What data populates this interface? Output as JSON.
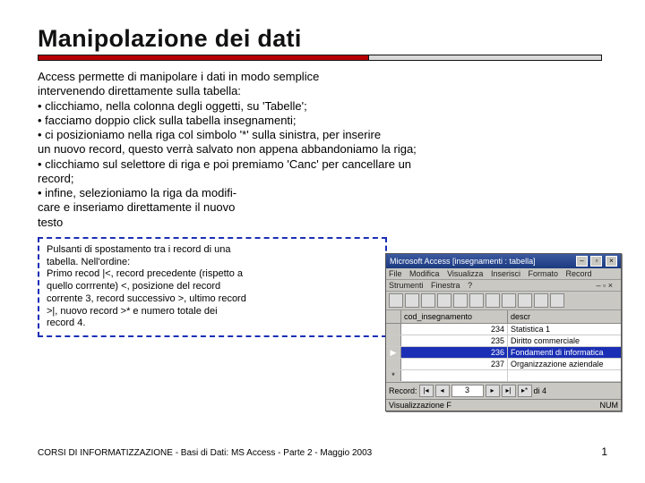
{
  "title": "Manipolazione dei dati",
  "body": {
    "intro1": "Access permette di manipolare i dati in modo semplice",
    "intro2": "intervenendo direttamente sulla tabella:",
    "b1": "• clicchiamo, nella colonna degli oggetti, su 'Tabelle';",
    "b2": "• facciamo doppio click sulla tabella insegnamenti;",
    "b3": "• ci posizioniamo nella riga col simbolo '*' sulla sinistra, per inserire",
    "b3b": "un nuovo record, questo verrà salvato non appena abbandoniamo la riga;",
    "b4": "• clicchiamo sul selettore di riga e poi premiamo 'Canc' per cancellare un",
    "b4b": "record;",
    "b5": "• infine, selezioniamo la riga da modifi-",
    "b5b": "care e inseriamo direttamente il nuovo",
    "b5c": "testo"
  },
  "callout": {
    "l1": "Pulsanti di spostamento tra i record di una",
    "l2": "tabella. Nell'ordine:",
    "l3": "Primo recod |<, record precedente (rispetto a",
    "l4": "quello corrrente) <, posizione del record",
    "l5": "corrente 3, record successivo >, ultimo record",
    "l6": ">|,  nuovo record >* e numero totale dei",
    "l7": "record 4."
  },
  "footer": "CORSI DI INFORMATIZZAZIONE - Basi di Dati: MS Access - Parte 2 - Maggio 2003",
  "pagenum": "1",
  "access": {
    "app_title": "Microsoft Access   [insegnamenti : tabella]",
    "menu1": {
      "file": "File",
      "modifica": "Modifica",
      "visualizza": "Visualizza",
      "inserisci": "Inserisci",
      "formato": "Formato",
      "record": "Record"
    },
    "menu2": {
      "strumenti": "Strumenti",
      "finestra": "Finestra",
      "help": "?",
      "close_inner": "– ▫ ×"
    },
    "headers": {
      "c1": "cod_insegnamento",
      "c2": "descr"
    },
    "rows": [
      {
        "sel": "",
        "c1": "234",
        "c2": "Statistica 1"
      },
      {
        "sel": "",
        "c1": "235",
        "c2": "Diritto commerciale"
      },
      {
        "sel": "▶",
        "c1": "236",
        "c2": "Fondamenti di informatica",
        "selected": true
      },
      {
        "sel": "",
        "c1": "237",
        "c2": "Organizzazione aziendale"
      },
      {
        "sel": "*",
        "c1": "",
        "c2": ""
      }
    ],
    "nav": {
      "label": "Record:",
      "first": "|◂",
      "prev": "◂",
      "pos": "3",
      "next": "▸",
      "last": "▸|",
      "new": "▸*",
      "of": "di 4"
    },
    "status": {
      "left": "Visualizzazione F",
      "right": "NUM"
    }
  }
}
